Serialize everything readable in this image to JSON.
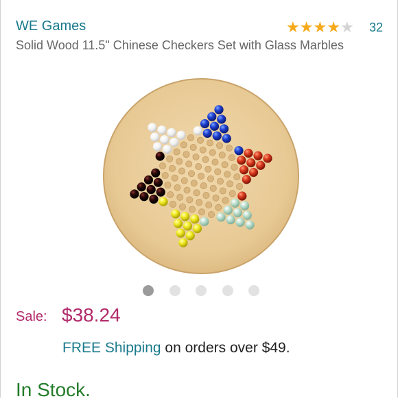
{
  "product": {
    "brand": "WE Games",
    "rating": 4,
    "rating_max": 5,
    "rating_count": "32",
    "title": "Solid Wood 11.5\" Chinese Checkers Set with Glass Marbles"
  },
  "image_carousel": {
    "count": 5,
    "active_index": 0
  },
  "price": {
    "label": "Sale:",
    "value": "$38.24"
  },
  "shipping": {
    "link": "FREE Shipping",
    "text": " on orders over $49."
  },
  "availability": "In Stock.",
  "colors": {
    "link": "#1a7a8c",
    "sale": "#b12a6a",
    "stock": "#237c2a",
    "star": "#f6a91a"
  },
  "marble_colors": [
    "mint-green",
    "white",
    "blue",
    "red",
    "yellow",
    "black"
  ]
}
